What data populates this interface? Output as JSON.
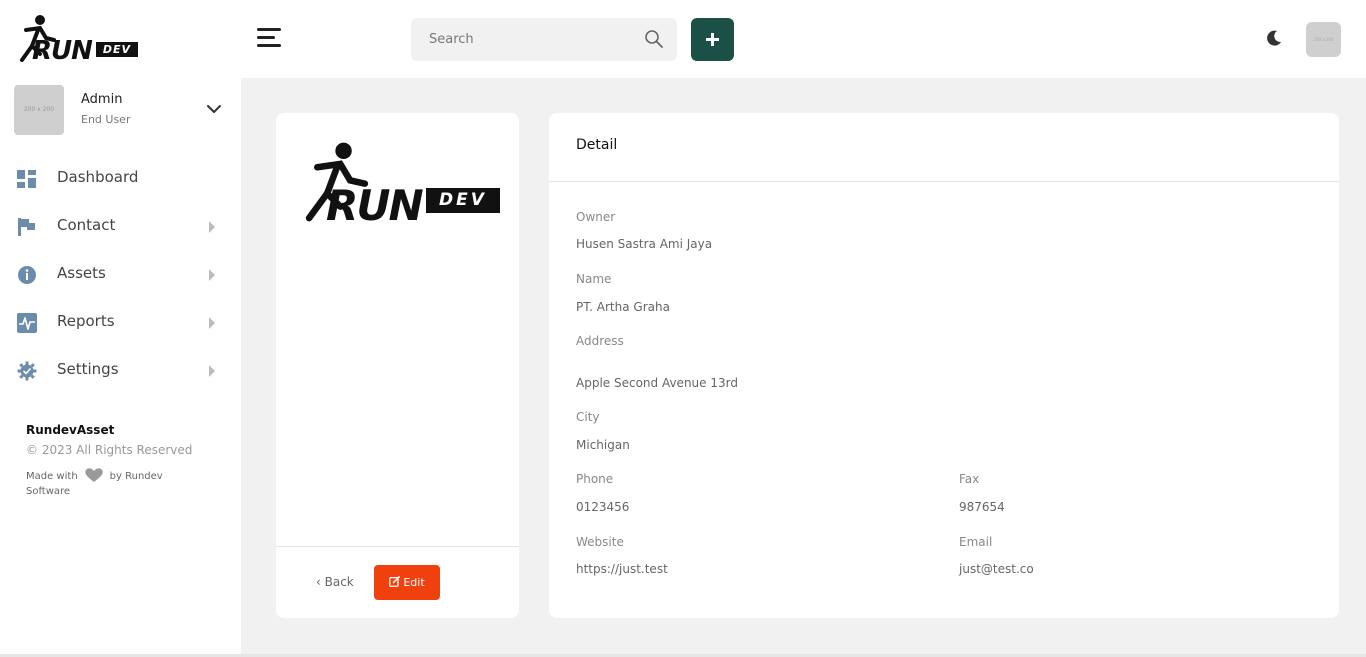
{
  "brand": {
    "word": "RUN",
    "badge": "DEV"
  },
  "user": {
    "avatar_text": "200 x 200",
    "name": "Admin",
    "role": "End User"
  },
  "nav": [
    {
      "label": "Dashboard",
      "icon": "dashboard-icon"
    },
    {
      "label": "Contact",
      "icon": "flag-icon"
    },
    {
      "label": "Assets",
      "icon": "info-icon"
    },
    {
      "label": "Reports",
      "icon": "activity-icon"
    },
    {
      "label": "Settings",
      "icon": "gear-icon"
    }
  ],
  "footer": {
    "title": "RundevAsset",
    "copyright": "© 2023 All Rights Reserved",
    "made_with": "Made with",
    "made_by": "by Rundev Software"
  },
  "topbar": {
    "search_placeholder": "Search",
    "avatar_text": "200 x 200"
  },
  "logo_card": {
    "back_label": "Back",
    "edit_label": "Edit"
  },
  "detail": {
    "title": "Detail",
    "owner_label": "Owner",
    "owner": "Husen Sastra Ami Jaya",
    "name_label": "Name",
    "name": "PT. Artha Graha",
    "address_label": "Address",
    "address": "Apple Second Avenue 13rd",
    "city_label": "City",
    "city": "Michigan",
    "phone_label": "Phone",
    "phone": "0123456",
    "fax_label": "Fax",
    "fax": "987654",
    "website_label": "Website",
    "website": "https://just.test",
    "email_label": "Email",
    "email": "just@test.co"
  },
  "colors": {
    "accent": "#1b5047",
    "edit": "#f0400e",
    "background": "#f1f1f1"
  }
}
